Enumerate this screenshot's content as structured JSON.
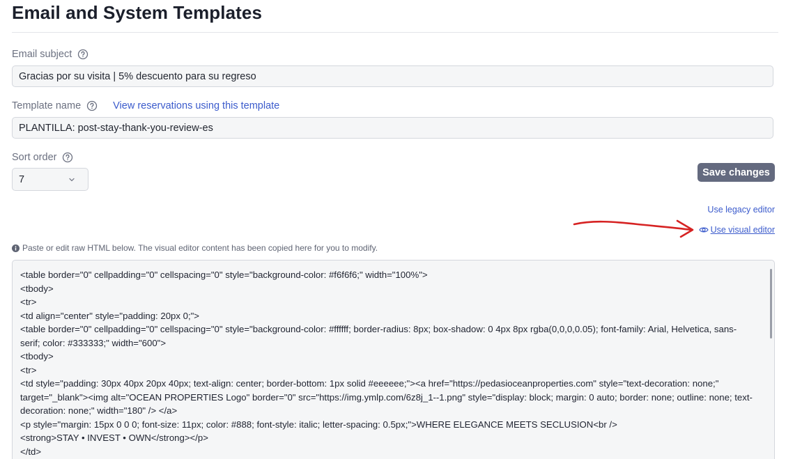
{
  "page": {
    "title": "Email and System Templates"
  },
  "email_subject": {
    "label": "Email subject",
    "value": "Gracias por su visita | 5% descuento para su regreso"
  },
  "template_name": {
    "label": "Template name",
    "link": "View reservations using this template",
    "value": "PLANTILLA: post-stay-thank-you-review-es"
  },
  "sort_order": {
    "label": "Sort order",
    "value": "7"
  },
  "actions": {
    "save_label": "Save changes",
    "legacy_editor": "Use legacy editor",
    "visual_editor": "Use visual editor"
  },
  "info": {
    "text": "Paste or edit raw HTML below. The visual editor content has been copied here for you to modify."
  },
  "code_lines": [
    "<table border=\"0\" cellpadding=\"0\" cellspacing=\"0\" style=\"background-color: #f6f6f6;\" width=\"100%\">",
    "<tbody>",
    "<tr>",
    "<td align=\"center\" style=\"padding: 20px 0;\">",
    "<table border=\"0\" cellpadding=\"0\" cellspacing=\"0\" style=\"background-color: #ffffff; border-radius: 8px; box-shadow: 0 4px 8px rgba(0,0,0,0.05); font-family: Arial, Helvetica, sans-serif; color: #333333;\" width=\"600\">",
    "<tbody>",
    "<tr>",
    "<td style=\"padding: 30px 40px 20px 40px; text-align: center; border-bottom: 1px solid #eeeeee;\"><a href=\"https://pedasioceanproperties.com\" style=\"text-decoration: none;\" target=\"_blank\"><img alt=\"OCEAN PROPERTIES Logo\" border=\"0\" src=\"https://img.ymlp.com/6z8j_1--1.png\" style=\"display: block; margin: 0 auto; border: none; outline: none; text-decoration: none;\" width=\"180\" /> </a>",
    "<p style=\"margin: 15px 0 0 0; font-size: 11px; color: #888; font-style: italic; letter-spacing: 0.5px;\">WHERE ELEGANCE MEETS SECLUSION<br />",
    "<strong>STAY • INVEST • OWN</strong></p>",
    "</td>"
  ],
  "colors": {
    "link": "#3b5bcc",
    "save_button_bg": "#646a7f",
    "annotation_arrow": "#d62222",
    "field_bg": "#f5f6f7"
  },
  "icons": {
    "help": "question-circle-icon",
    "chevron": "chevron-down-icon",
    "eye": "eye-icon",
    "info": "info-circle-icon"
  }
}
